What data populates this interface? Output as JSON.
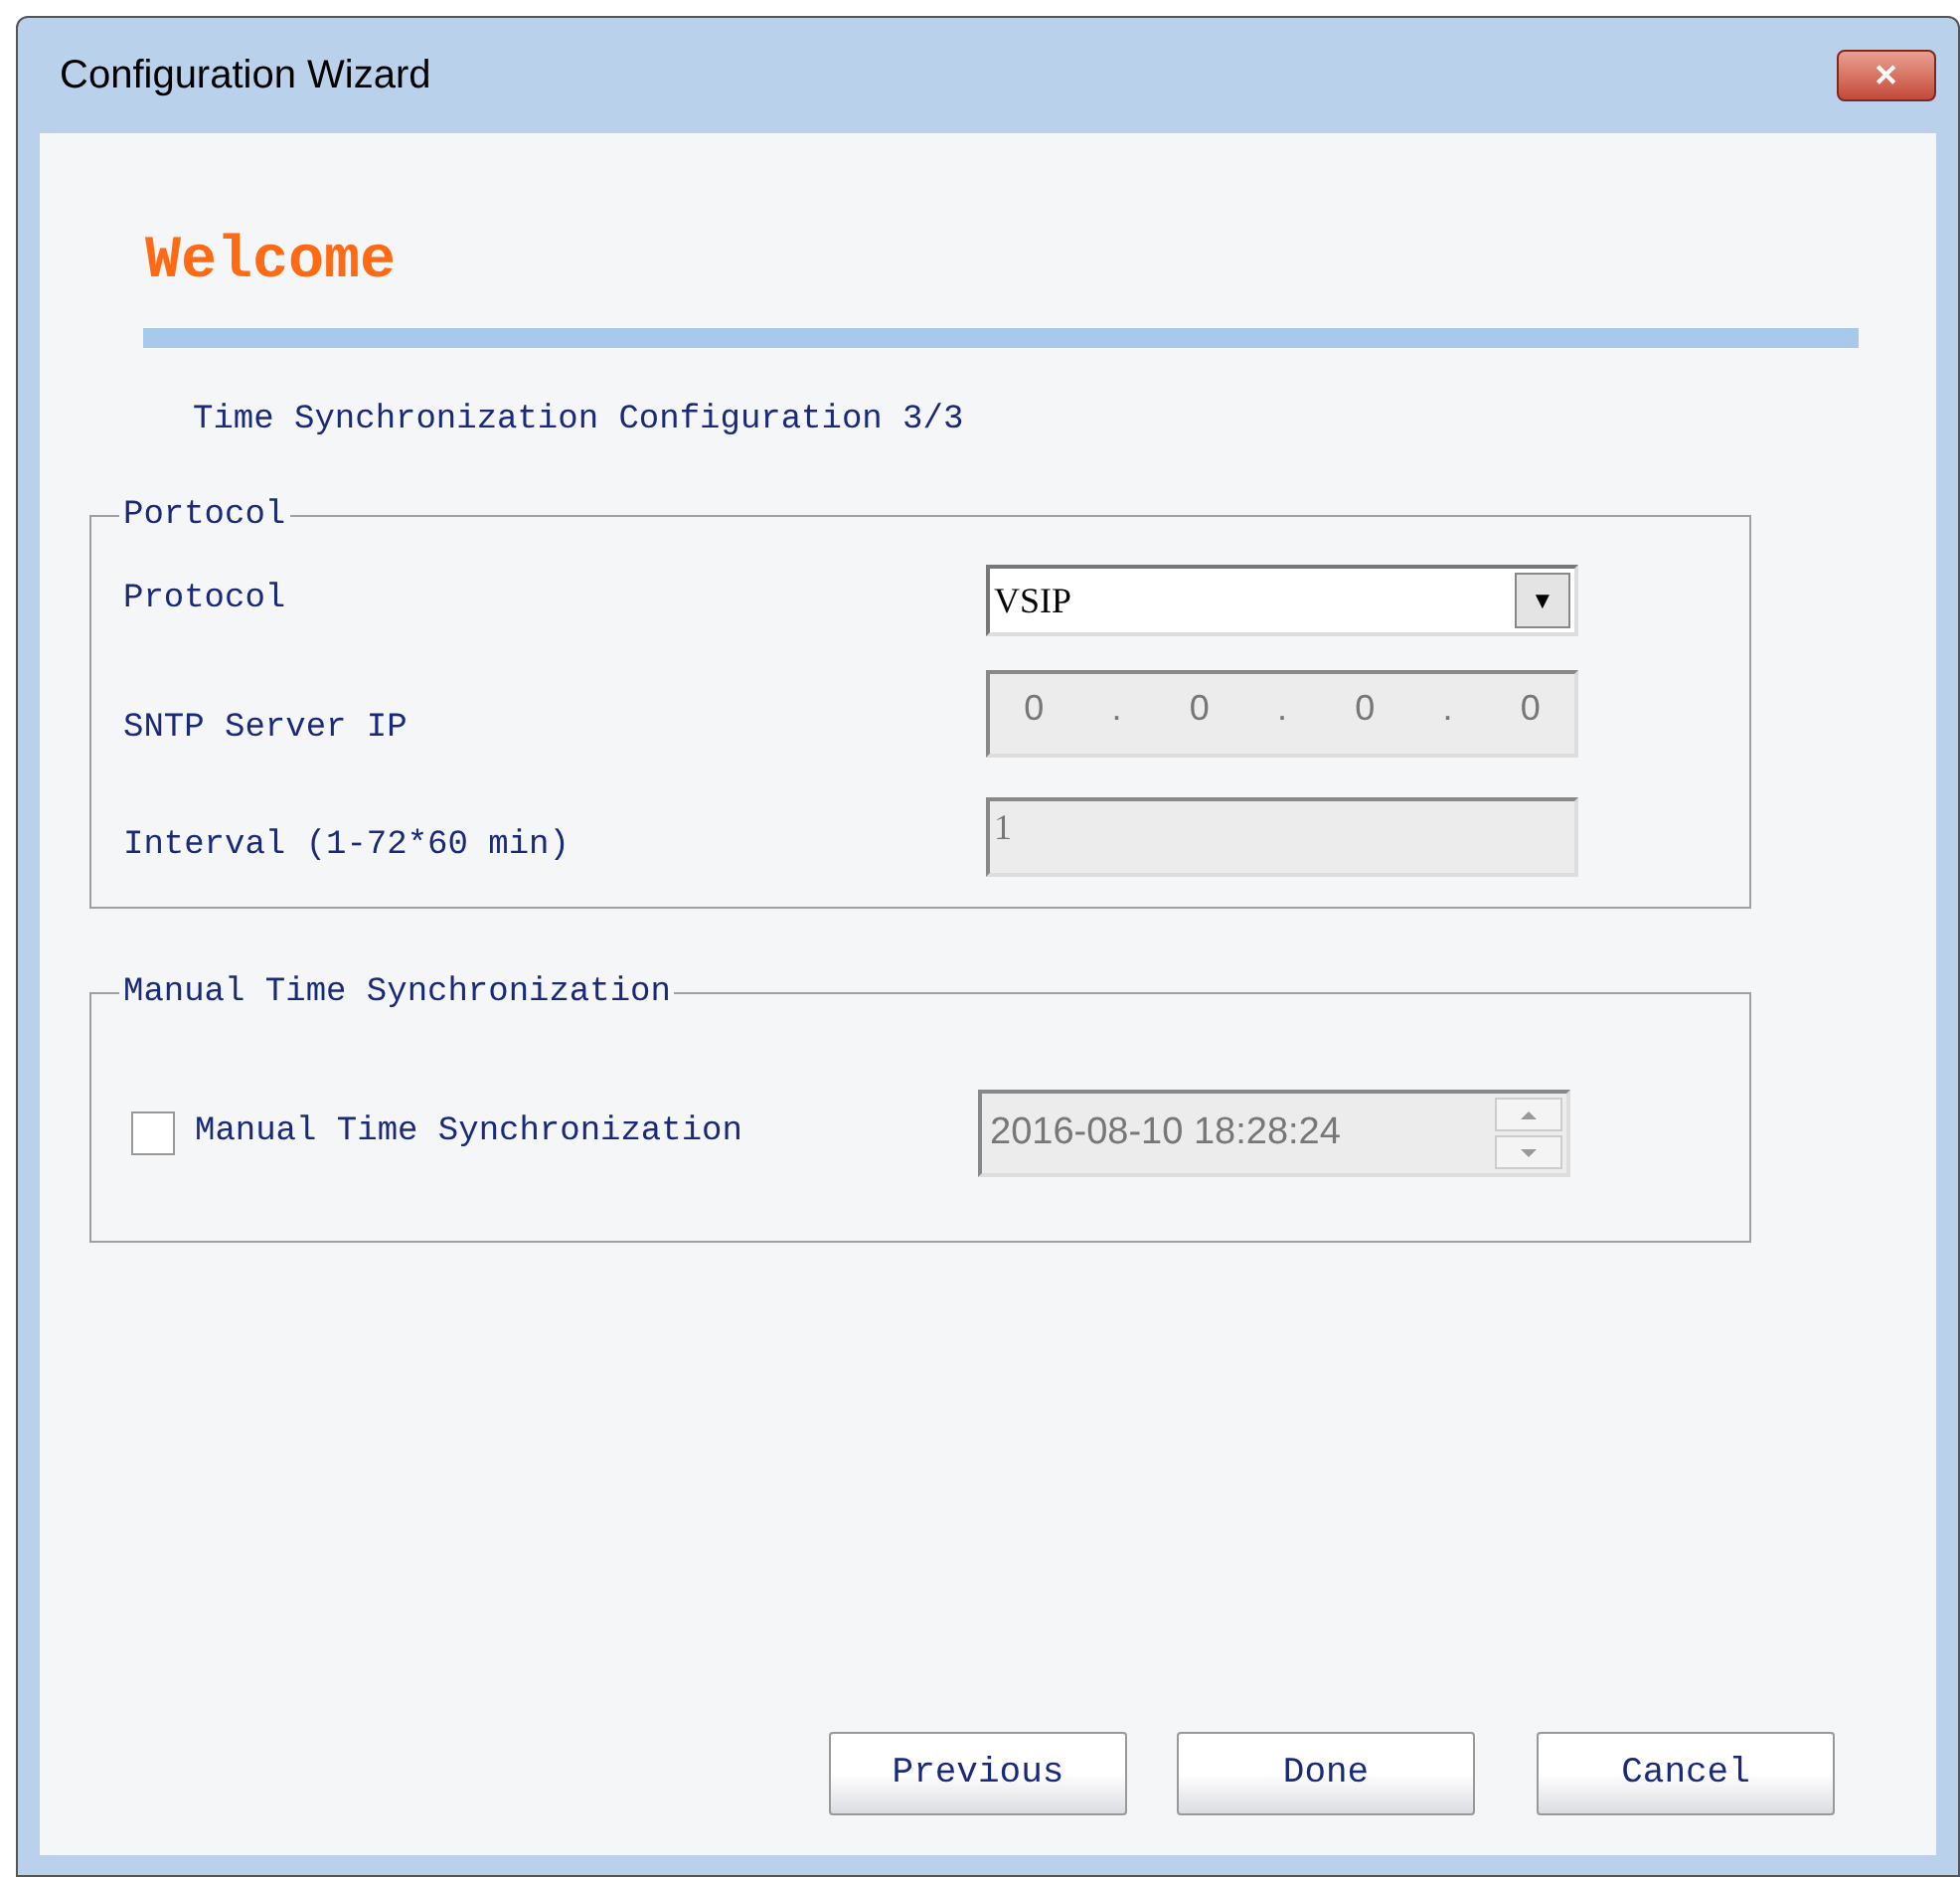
{
  "window": {
    "title": "Configuration Wizard",
    "close_glyph": "✕"
  },
  "heading": "Welcome",
  "step": "Time Synchronization Configuration 3/3",
  "protocol_group": {
    "legend": "Portocol",
    "protocol": {
      "label": "Protocol",
      "value": "VSIP",
      "arrow": "▼"
    },
    "sntp_ip": {
      "label": "SNTP Server IP",
      "octets": [
        "0",
        "0",
        "0",
        "0"
      ],
      "separator": ".",
      "disabled": true
    },
    "interval": {
      "label": "Interval (1-72*60 min)",
      "value": "1",
      "disabled": true
    }
  },
  "manual_group": {
    "legend": "Manual Time Synchronization",
    "checkbox": {
      "label": "Manual Time Synchronization",
      "checked": false
    },
    "datetime": {
      "value": "2016-08-10 18:28:24",
      "disabled": true
    }
  },
  "buttons": [
    {
      "label": "Previous"
    },
    {
      "label": "Done"
    },
    {
      "label": "Cancel"
    }
  ]
}
